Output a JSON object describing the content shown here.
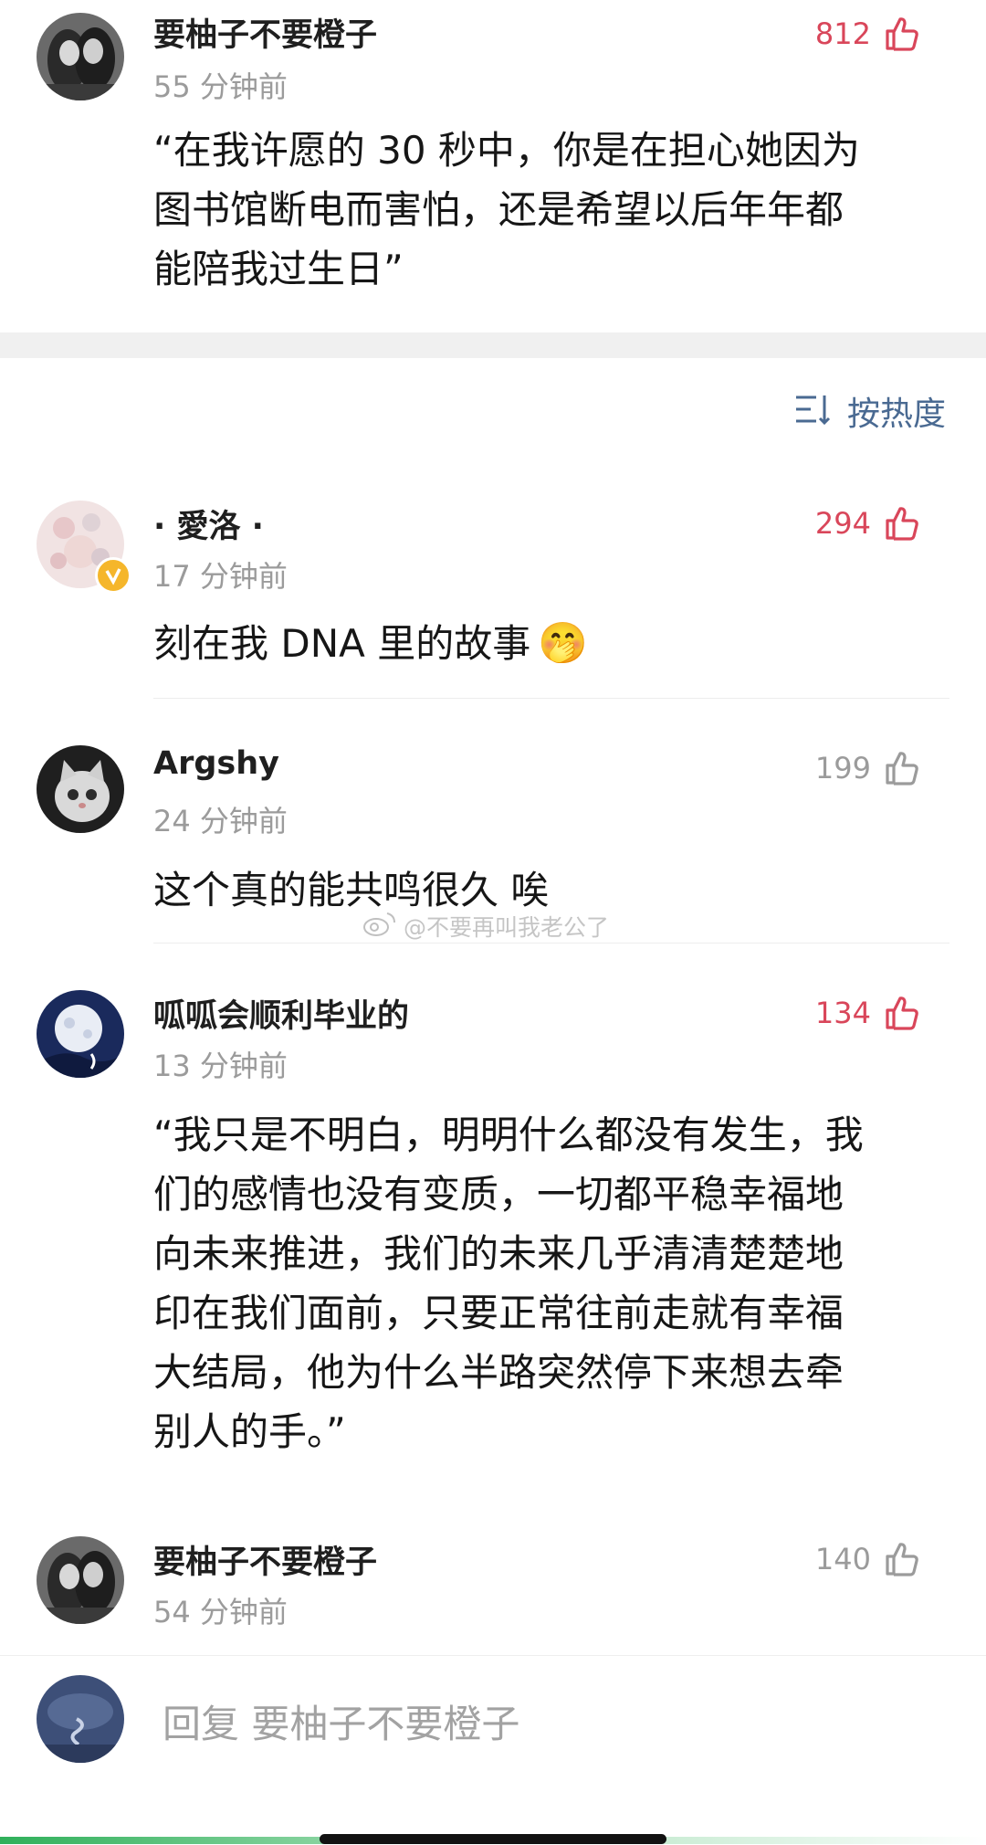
{
  "top_post": {
    "author": "要柚子不要橙子",
    "time": "55 分钟前",
    "likes": "812",
    "liked": true,
    "text_lines": [
      "“在我许愿的 30 秒中，你是在担心她因为",
      "图书馆断电而害怕，还是希望以后年年都",
      "能陪我过生日”"
    ]
  },
  "sort": {
    "label": "按热度",
    "icon": "sort-lines-icon"
  },
  "comments": [
    {
      "author": "· 愛洛 ·",
      "time": "17 分钟前",
      "likes": "294",
      "liked": true,
      "verified": true,
      "text_lines": [
        "刻在我 DNA 里的故事"
      ],
      "emoji": "🤭"
    },
    {
      "author": "Argshy",
      "time": "24 分钟前",
      "likes": "199",
      "liked": false,
      "text_lines": [
        "这个真的能共鸣很久 唉"
      ]
    },
    {
      "author": "呱呱会顺利毕业的",
      "time": "13 分钟前",
      "likes": "134",
      "liked": true,
      "text_lines": [
        "“我只是不明白，明明什么都没有发生，我",
        "们的感情也没有变质，一切都平稳幸福地",
        "向未来推进，我们的未来几乎清清楚楚地",
        "印在我们面前，只要正常往前走就有幸福",
        "大结局，他为什么半路突然停下来想去牵",
        "别人的手。”"
      ]
    },
    {
      "author": "要柚子不要橙子",
      "time": "54 分钟前",
      "likes": "140",
      "liked": false,
      "text_lines": []
    }
  ],
  "watermark": "@不要再叫我老公了",
  "reply": {
    "placeholder": "回复 要柚子不要橙子"
  },
  "colors": {
    "liked": "#d9465a",
    "unliked": "#9b9b9b",
    "sort_text": "#4a6a92",
    "time_text": "#9b9b9b"
  }
}
